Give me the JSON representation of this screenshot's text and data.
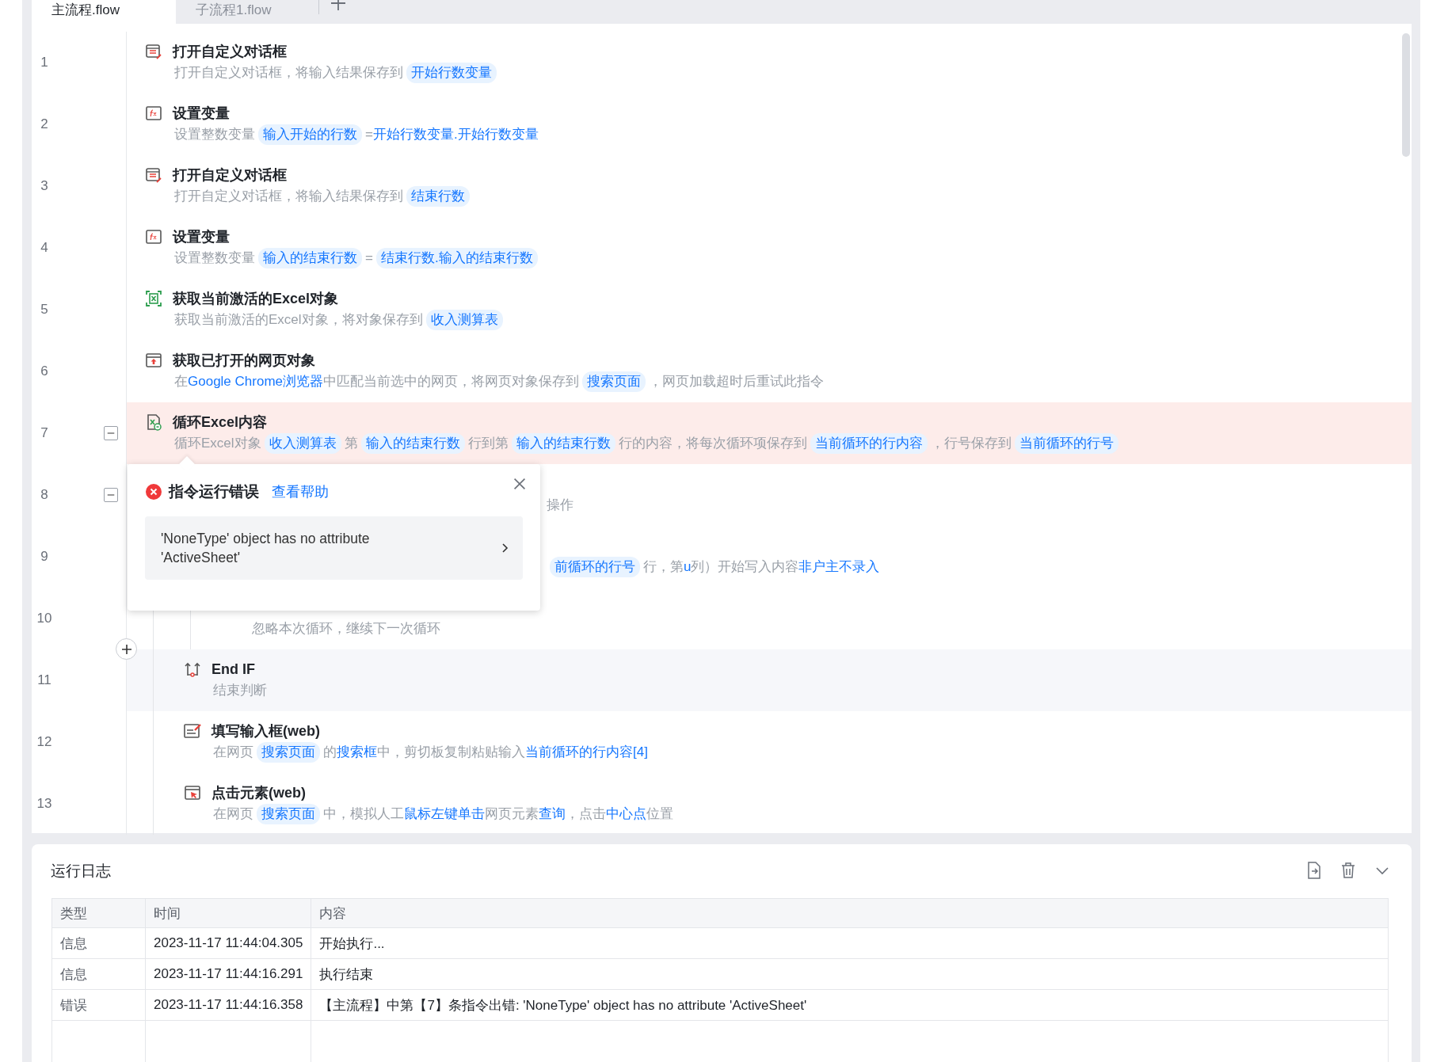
{
  "tabs": [
    {
      "label": "主流程.flow",
      "selected": true
    },
    {
      "label": "子流程1.flow",
      "selected": false
    }
  ],
  "steps": [
    {
      "line": "1",
      "kind": "dialog",
      "title": "打开自定义对话框",
      "description": [
        {
          "kind": "text",
          "text": "打开自定义对话框，将输入结果保存到"
        },
        {
          "kind": "pill",
          "text": "开始行数变量"
        }
      ]
    },
    {
      "line": "2",
      "kind": "variable",
      "title": "设置变量",
      "description": [
        {
          "kind": "text",
          "text": "设置整数变量"
        },
        {
          "kind": "pill",
          "text": "输入开始的行数"
        },
        {
          "kind": "text",
          "text": "="
        },
        {
          "kind": "link",
          "text": "开始行数变量.开始行数变量"
        }
      ]
    },
    {
      "line": "3",
      "kind": "dialog",
      "title": "打开自定义对话框",
      "description": [
        {
          "kind": "text",
          "text": "打开自定义对话框，将输入结果保存到"
        },
        {
          "kind": "pill",
          "text": "结束行数"
        }
      ]
    },
    {
      "line": "4",
      "kind": "variable",
      "title": "设置变量",
      "description": [
        {
          "kind": "text",
          "text": "设置整数变量"
        },
        {
          "kind": "pill",
          "text": "输入的结束行数"
        },
        {
          "kind": "text",
          "text": "="
        },
        {
          "kind": "pill",
          "text": "结束行数.输入的结束行数"
        }
      ]
    },
    {
      "line": "5",
      "kind": "excel",
      "title": "获取当前激活的Excel对象",
      "description": [
        {
          "kind": "text",
          "text": "获取当前激活的Excel对象，将对象保存到"
        },
        {
          "kind": "pill",
          "text": "收入测算表"
        }
      ]
    },
    {
      "line": "6",
      "kind": "browser",
      "title": "获取已打开的网页对象",
      "description": [
        {
          "kind": "text",
          "text": "在"
        },
        {
          "kind": "link",
          "text": "Google Chrome浏览器"
        },
        {
          "kind": "text",
          "text": "中匹配当前选中的网页，将网页对象保存到"
        },
        {
          "kind": "pill",
          "text": "搜索页面"
        },
        {
          "kind": "text",
          "text": "，网页加载超时后重试此指令"
        }
      ]
    },
    {
      "line": "7",
      "kind": "excel-loop",
      "title": "循环Excel内容",
      "error": true,
      "expanded": true,
      "description": [
        {
          "kind": "text",
          "text": "循环Excel对象"
        },
        {
          "kind": "pill",
          "text": "收入测算表"
        },
        {
          "kind": "text",
          "text": "第"
        },
        {
          "kind": "pill",
          "text": "输入的结束行数"
        },
        {
          "kind": "text",
          "text": "行到第"
        },
        {
          "kind": "pill",
          "text": "输入的结束行数"
        },
        {
          "kind": "text",
          "text": "行的内容，将每次循环项保存到"
        },
        {
          "kind": "pill",
          "text": "当前循环的行内容"
        },
        {
          "kind": "text",
          "text": "，行号保存到"
        },
        {
          "kind": "pill",
          "text": "当前循环的行号"
        }
      ],
      "children": [
        {
          "line": "8",
          "expanded": true,
          "covered": true,
          "description": [
            {
              "kind": "text",
              "text": "操作"
            }
          ],
          "children": [
            {
              "line": "9",
              "covered": true,
              "description": [
                {
                  "kind": "pill",
                  "text": "前循环的行号"
                },
                {
                  "kind": "text",
                  "text": "行，第"
                },
                {
                  "kind": "link",
                  "text": "u"
                },
                {
                  "kind": "text",
                  "text": "列）开始写入内容"
                },
                {
                  "kind": "link",
                  "text": "非户主不录入"
                }
              ]
            },
            {
              "line": "10",
              "description": [
                {
                  "kind": "text",
                  "text": "忽略本次循环，继续下一次循环"
                }
              ]
            }
          ]
        },
        {
          "line": "11",
          "kind": "end-if",
          "title": "End IF",
          "highlighted": true,
          "description": [
            {
              "kind": "text",
              "text": "结束判断"
            }
          ]
        },
        {
          "line": "12",
          "kind": "input-web",
          "title": "填写输入框(web)",
          "description": [
            {
              "kind": "text",
              "text": "在网页"
            },
            {
              "kind": "pill",
              "text": "搜索页面"
            },
            {
              "kind": "text",
              "text": "的"
            },
            {
              "kind": "link",
              "text": "搜索框"
            },
            {
              "kind": "text",
              "text": "中，剪切板复制粘贴输入"
            },
            {
              "kind": "link",
              "text": "当前循环的行内容[4]"
            }
          ]
        },
        {
          "line": "13",
          "kind": "click-web",
          "title": "点击元素(web)",
          "description": [
            {
              "kind": "text",
              "text": "在网页"
            },
            {
              "kind": "pill",
              "text": "搜索页面"
            },
            {
              "kind": "text",
              "text": "中，模拟人工"
            },
            {
              "kind": "link",
              "text": "鼠标左键单击"
            },
            {
              "kind": "text",
              "text": "网页元素"
            },
            {
              "kind": "link",
              "text": "查询"
            },
            {
              "kind": "text",
              "text": "，点击"
            },
            {
              "kind": "link",
              "text": "中心点"
            },
            {
              "kind": "text",
              "text": "位置"
            }
          ]
        }
      ]
    }
  ],
  "error_popup": {
    "title": "指令运行错误",
    "help_link": "查看帮助",
    "message": "'NoneType' object has no attribute 'ActiveSheet'"
  },
  "log": {
    "title": "运行日志",
    "columns": [
      "类型",
      "时间",
      "内容"
    ],
    "rows": [
      [
        "信息",
        "2023-11-17 11:44:04.305",
        "开始执行..."
      ],
      [
        "信息",
        "2023-11-17 11:44:16.291",
        "执行结束"
      ],
      [
        "错误",
        "2023-11-17 11:44:16.358",
        "【主流程】中第【7】条指令出错: 'NoneType' object has no attribute 'ActiveSheet'"
      ]
    ]
  }
}
